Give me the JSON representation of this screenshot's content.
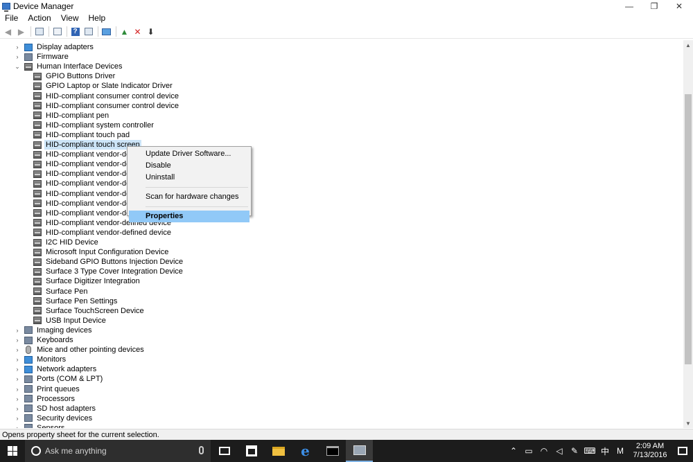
{
  "window": {
    "title": "Device Manager",
    "controls": {
      "minimize": "—",
      "restore": "❐",
      "close": "✕"
    }
  },
  "menu": [
    "File",
    "Action",
    "View",
    "Help"
  ],
  "toolbar_icons": [
    "back-arrow-icon",
    "forward-arrow-icon",
    "console-tree-icon",
    "properties-icon",
    "help-icon",
    "view-icon",
    "monitor-icon",
    "update-driver-icon",
    "uninstall-icon",
    "download-icon"
  ],
  "tree": {
    "rows": [
      {
        "label": "Display adapters",
        "level": 0,
        "expander": "›",
        "icon": "display-adapter-icon"
      },
      {
        "label": "Firmware",
        "level": 0,
        "expander": "›",
        "icon": "category-icon"
      },
      {
        "label": "Human Interface Devices",
        "level": 0,
        "expander": "⌄",
        "icon": "hid-icon"
      },
      {
        "label": "GPIO Buttons Driver",
        "level": 1,
        "icon": "hid-icon"
      },
      {
        "label": "GPIO Laptop or Slate Indicator Driver",
        "level": 1,
        "icon": "hid-icon"
      },
      {
        "label": "HID-compliant consumer control device",
        "level": 1,
        "icon": "hid-icon"
      },
      {
        "label": "HID-compliant consumer control device",
        "level": 1,
        "icon": "hid-icon"
      },
      {
        "label": "HID-compliant pen",
        "level": 1,
        "icon": "hid-icon"
      },
      {
        "label": "HID-compliant system controller",
        "level": 1,
        "icon": "hid-icon"
      },
      {
        "label": "HID-compliant touch pad",
        "level": 1,
        "icon": "hid-icon"
      },
      {
        "label": "HID-compliant touch screen",
        "level": 1,
        "icon": "hid-icon",
        "selected": true
      },
      {
        "label": "HID-compliant vendor-defin",
        "level": 1,
        "icon": "hid-icon"
      },
      {
        "label": "HID-compliant vendor-defin",
        "level": 1,
        "icon": "hid-icon"
      },
      {
        "label": "HID-compliant vendor-defin",
        "level": 1,
        "icon": "hid-icon"
      },
      {
        "label": "HID-compliant vendor-defin",
        "level": 1,
        "icon": "hid-icon"
      },
      {
        "label": "HID-compliant vendor-defin",
        "level": 1,
        "icon": "hid-icon"
      },
      {
        "label": "HID-compliant vendor-defin",
        "level": 1,
        "icon": "hid-icon"
      },
      {
        "label": "HID-compliant vendor-defin",
        "level": 1,
        "icon": "hid-icon"
      },
      {
        "label": "HID-compliant vendor-defined device",
        "level": 1,
        "icon": "hid-icon"
      },
      {
        "label": "HID-compliant vendor-defined device",
        "level": 1,
        "icon": "hid-icon"
      },
      {
        "label": "I2C HID Device",
        "level": 1,
        "icon": "hid-icon"
      },
      {
        "label": "Microsoft Input Configuration Device",
        "level": 1,
        "icon": "hid-icon"
      },
      {
        "label": "Sideband GPIO Buttons Injection Device",
        "level": 1,
        "icon": "hid-icon"
      },
      {
        "label": "Surface 3 Type Cover Integration Device",
        "level": 1,
        "icon": "hid-icon"
      },
      {
        "label": "Surface Digitizer Integration",
        "level": 1,
        "icon": "hid-icon"
      },
      {
        "label": "Surface Pen",
        "level": 1,
        "icon": "hid-icon"
      },
      {
        "label": "Surface Pen Settings",
        "level": 1,
        "icon": "hid-icon"
      },
      {
        "label": "Surface TouchScreen Device",
        "level": 1,
        "icon": "hid-icon"
      },
      {
        "label": "USB Input Device",
        "level": 1,
        "icon": "hid-icon"
      },
      {
        "label": "Imaging devices",
        "level": 0,
        "expander": "›",
        "icon": "camera-icon"
      },
      {
        "label": "Keyboards",
        "level": 0,
        "expander": "›",
        "icon": "keyboard-icon"
      },
      {
        "label": "Mice and other pointing devices",
        "level": 0,
        "expander": "›",
        "icon": "mouse-icon"
      },
      {
        "label": "Monitors",
        "level": 0,
        "expander": "›",
        "icon": "monitor-icon"
      },
      {
        "label": "Network adapters",
        "level": 0,
        "expander": "›",
        "icon": "network-adapter-icon"
      },
      {
        "label": "Ports (COM & LPT)",
        "level": 0,
        "expander": "›",
        "icon": "port-icon"
      },
      {
        "label": "Print queues",
        "level": 0,
        "expander": "›",
        "icon": "printer-icon"
      },
      {
        "label": "Processors",
        "level": 0,
        "expander": "›",
        "icon": "processor-icon"
      },
      {
        "label": "SD host adapters",
        "level": 0,
        "expander": "›",
        "icon": "sd-card-icon"
      },
      {
        "label": "Security devices",
        "level": 0,
        "expander": "›",
        "icon": "security-device-icon"
      },
      {
        "label": "Sensors",
        "level": 0,
        "expander": "›",
        "icon": "sensor-icon"
      }
    ]
  },
  "context_menu": {
    "items": [
      {
        "label": "Update Driver Software..."
      },
      {
        "label": "Disable"
      },
      {
        "label": "Uninstall"
      },
      {
        "separator": true
      },
      {
        "label": "Scan for hardware changes"
      },
      {
        "separator": true
      },
      {
        "label": "Properties",
        "bold": true,
        "highlight": true
      }
    ]
  },
  "statusbar": {
    "text": "Opens property sheet for the current selection."
  },
  "taskbar": {
    "search_placeholder": "Ask me anything",
    "tray": {
      "lang": "中",
      "ime": "M",
      "time": "2:09 AM",
      "date": "7/13/2016"
    }
  },
  "colors": {
    "selection": "#cce4f7",
    "menu_highlight": "#91c9f7",
    "taskbar": "#1c1c1c"
  }
}
